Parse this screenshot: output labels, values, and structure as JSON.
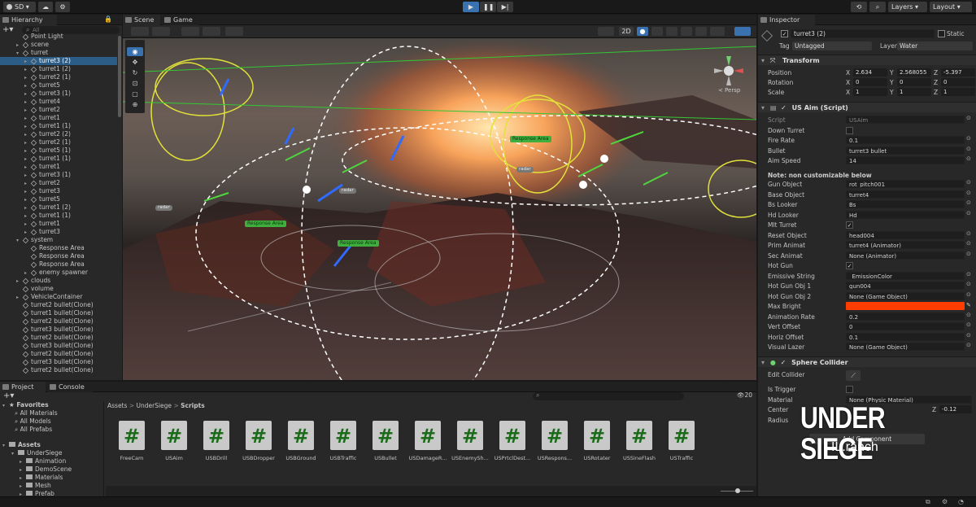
{
  "toolbar": {
    "account": "SD",
    "layers": "Layers",
    "layout": "Layout"
  },
  "hierarchy": {
    "tab": "Hierarchy",
    "search_placeholder": "All",
    "rows": [
      {
        "label": "Point Light",
        "indent": 0,
        "arrow": ""
      },
      {
        "label": "scene",
        "indent": 0,
        "arrow": "▸"
      },
      {
        "label": "turret",
        "indent": 0,
        "arrow": "▾"
      },
      {
        "label": "turret3 (2)",
        "indent": 1,
        "arrow": "▸",
        "selected": true
      },
      {
        "label": "turret1 (2)",
        "indent": 1,
        "arrow": "▸"
      },
      {
        "label": "turret2 (1)",
        "indent": 1,
        "arrow": "▸"
      },
      {
        "label": "turret5",
        "indent": 1,
        "arrow": "▸"
      },
      {
        "label": "turret3 (1)",
        "indent": 1,
        "arrow": "▸"
      },
      {
        "label": "turret4",
        "indent": 1,
        "arrow": "▸"
      },
      {
        "label": "turret2",
        "indent": 1,
        "arrow": "▸"
      },
      {
        "label": "turret1",
        "indent": 1,
        "arrow": "▸"
      },
      {
        "label": "turret1 (1)",
        "indent": 1,
        "arrow": "▸"
      },
      {
        "label": "turret2 (2)",
        "indent": 1,
        "arrow": "▸"
      },
      {
        "label": "turret2 (1)",
        "indent": 1,
        "arrow": "▸"
      },
      {
        "label": "turret5 (1)",
        "indent": 1,
        "arrow": "▸"
      },
      {
        "label": "turret1 (1)",
        "indent": 1,
        "arrow": "▸"
      },
      {
        "label": "turret1",
        "indent": 1,
        "arrow": "▸"
      },
      {
        "label": "turret3 (1)",
        "indent": 1,
        "arrow": "▸"
      },
      {
        "label": "turret2",
        "indent": 1,
        "arrow": "▸"
      },
      {
        "label": "turret3",
        "indent": 1,
        "arrow": "▸"
      },
      {
        "label": "turret5",
        "indent": 1,
        "arrow": "▸"
      },
      {
        "label": "turret1 (2)",
        "indent": 1,
        "arrow": "▸"
      },
      {
        "label": "turret1 (1)",
        "indent": 1,
        "arrow": "▸"
      },
      {
        "label": "turret1",
        "indent": 1,
        "arrow": "▸"
      },
      {
        "label": "turret3",
        "indent": 1,
        "arrow": "▸"
      },
      {
        "label": "system",
        "indent": 0,
        "arrow": "▾"
      },
      {
        "label": "Response Area",
        "indent": 1,
        "arrow": ""
      },
      {
        "label": "Response Area",
        "indent": 1,
        "arrow": ""
      },
      {
        "label": "Response Area",
        "indent": 1,
        "arrow": ""
      },
      {
        "label": "enemy spawner",
        "indent": 1,
        "arrow": "▸"
      },
      {
        "label": "clouds",
        "indent": 0,
        "arrow": "▸"
      },
      {
        "label": "volume",
        "indent": 0,
        "arrow": ""
      },
      {
        "label": "VehicleContainer",
        "indent": 0,
        "arrow": "▸"
      },
      {
        "label": "turret2 bullet(Clone)",
        "indent": 0,
        "arrow": ""
      },
      {
        "label": "turret1 bullet(Clone)",
        "indent": 0,
        "arrow": ""
      },
      {
        "label": "turret2 bullet(Clone)",
        "indent": 0,
        "arrow": ""
      },
      {
        "label": "turret3 bullet(Clone)",
        "indent": 0,
        "arrow": ""
      },
      {
        "label": "turret2 bullet(Clone)",
        "indent": 0,
        "arrow": ""
      },
      {
        "label": "turret3 bullet(Clone)",
        "indent": 0,
        "arrow": ""
      },
      {
        "label": "turret2 bullet(Clone)",
        "indent": 0,
        "arrow": ""
      },
      {
        "label": "turret3 bullet(Clone)",
        "indent": 0,
        "arrow": ""
      },
      {
        "label": "turret2 bullet(Clone)",
        "indent": 0,
        "arrow": ""
      }
    ]
  },
  "scene": {
    "tab_scene": "Scene",
    "tab_game": "Game",
    "mode_2d": "2D",
    "persp": "< Persp",
    "labels": [
      "Response Area",
      "Response Area",
      "Response Area",
      "Response Area"
    ],
    "small_labels": [
      "radar",
      "radar",
      "radar"
    ]
  },
  "inspector": {
    "tab": "Inspector",
    "object_name": "turret3 (2)",
    "static_label": "Static",
    "tag_label": "Tag",
    "tag_value": "Untagged",
    "layer_label": "Layer",
    "layer_value": "Water",
    "transform": {
      "title": "Transform",
      "position_label": "Position",
      "rotation_label": "Rotation",
      "scale_label": "Scale",
      "position": [
        "2.634",
        "2.568055",
        "-5.397"
      ],
      "rotation": [
        "0",
        "0",
        "0"
      ],
      "scale": [
        "1",
        "1",
        "1"
      ],
      "axes": [
        "X",
        "Y",
        "Z"
      ]
    },
    "usaim": {
      "title": "US Aim (Script)",
      "fields": [
        {
          "label": "Script",
          "value": "USAim"
        },
        {
          "label": "Down Turret",
          "value": ""
        },
        {
          "label": "Fire Rate",
          "value": "0.1"
        },
        {
          "label": "Bullet",
          "value": "turret3 bullet"
        },
        {
          "label": "Aim Speed",
          "value": "14"
        }
      ],
      "note": "Note: non customizable below",
      "fields2": [
        {
          "label": "Gun Object",
          "value": "rot_pitch001"
        },
        {
          "label": "Base Object",
          "value": "turret4"
        },
        {
          "label": "Bs Looker",
          "value": "Bs"
        },
        {
          "label": "Hd Looker",
          "value": "Hd"
        },
        {
          "label": "Mlt Turret",
          "value": "✓"
        },
        {
          "label": "Reset Object",
          "value": "head004"
        },
        {
          "label": "Prim Animat",
          "value": "turret4 (Animator)"
        },
        {
          "label": "Sec Animat",
          "value": "None (Animator)"
        },
        {
          "label": "Hot Gun",
          "value": "✓"
        },
        {
          "label": "Emissive String",
          "value": "_EmissionColor"
        },
        {
          "label": "Hot Gun Obj 1",
          "value": "gun004"
        },
        {
          "label": "Hot Gun Obj 2",
          "value": "None (Game Object)"
        },
        {
          "label": "Max Bright",
          "value": ""
        },
        {
          "label": "Animation Rate",
          "value": "0.2"
        },
        {
          "label": "Vert Offset",
          "value": "0"
        },
        {
          "label": "Horiz Offset",
          "value": "0.1"
        },
        {
          "label": "Visual Lazer",
          "value": "None (Game Object)"
        }
      ]
    },
    "collider": {
      "title": "Sphere Collider",
      "edit_label": "Edit Collider",
      "is_trigger": "Is Trigger",
      "material_label": "Material",
      "material_value": "None (Physic Material)",
      "center_label": "Center",
      "center_z": "-0.12",
      "radius_label": "Radius"
    },
    "add_component": "Add Component"
  },
  "project": {
    "tab_project": "Project",
    "tab_console": "Console",
    "count": "20",
    "breadcrumb": [
      "Assets",
      "UnderSiege",
      "Scripts"
    ],
    "favorites": {
      "title": "Favorites",
      "items": [
        "All Materials",
        "All Models",
        "All Prefabs"
      ]
    },
    "assets": {
      "title": "Assets",
      "items": [
        "UnderSiege",
        "Animation",
        "DemoScene",
        "Materials",
        "Mesh",
        "Prefab"
      ]
    },
    "scripts": [
      "FreeCam",
      "USAim",
      "USBDrill",
      "USBDropper",
      "USBGround",
      "USBTraffic",
      "USBullet",
      "USDamageR...",
      "USEnemySh...",
      "USPrtclDest...",
      "USRespons...",
      "USRotater",
      "USSineFlash",
      "USTraffic"
    ]
  },
  "watermark": {
    "title": "UNDER SIEGE",
    "subtitle": "IL.ranch"
  },
  "colors": {
    "accent": "#2c5d87",
    "selection": "#2c5d87",
    "max_bright": "#ff3d00",
    "panel": "#282828",
    "scene_label": "#3fae3f"
  }
}
